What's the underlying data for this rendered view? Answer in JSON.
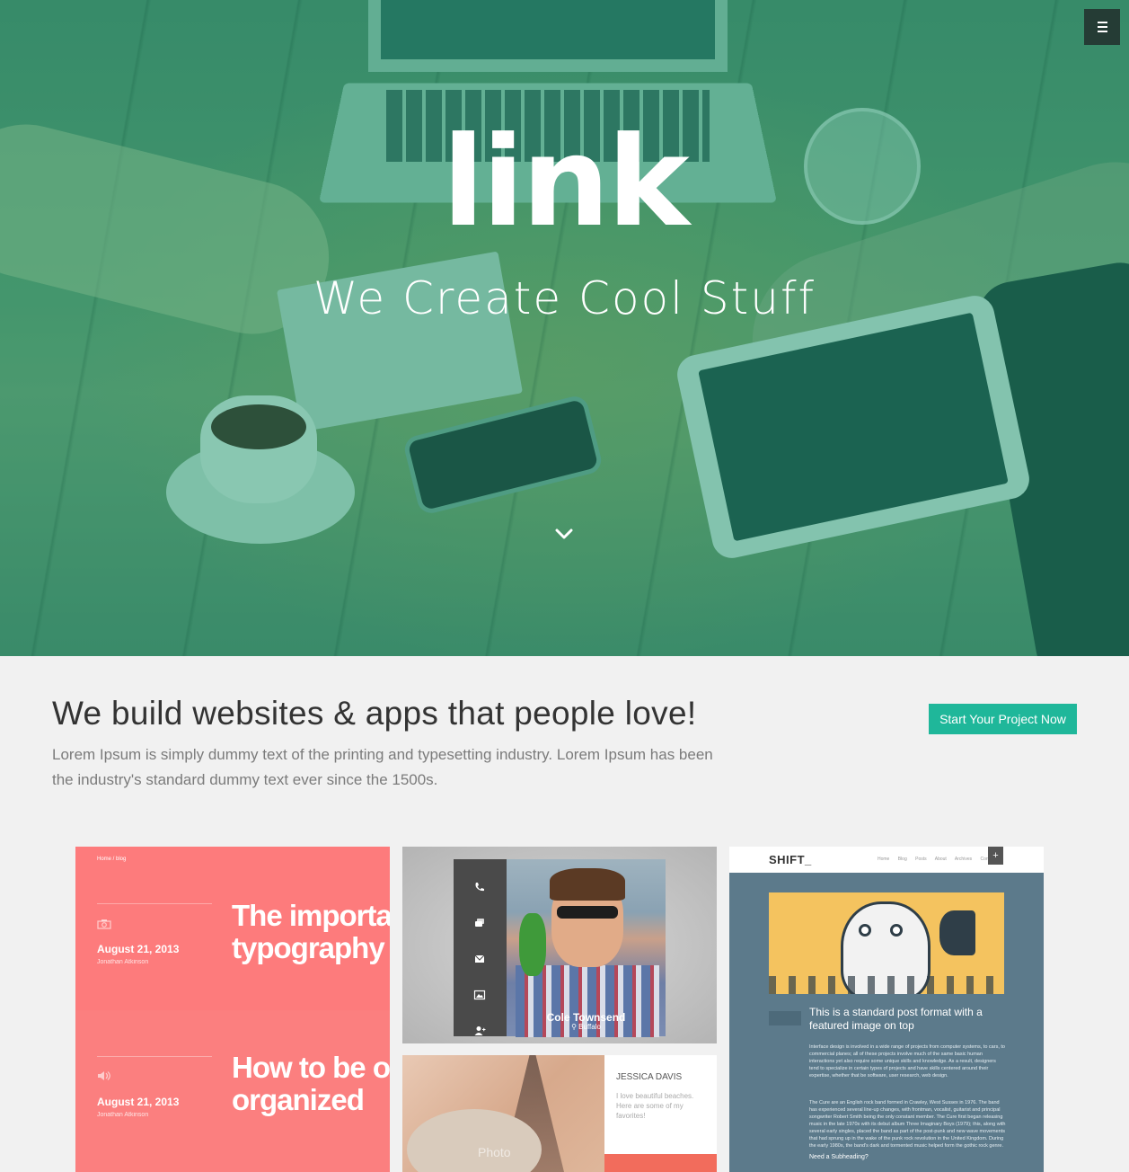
{
  "hero": {
    "brand": "link",
    "tagline": "We Create Cool Stuff"
  },
  "intro": {
    "title": "We build websites & apps that people love!",
    "text": "Lorem Ipsum is simply dummy text of the printing and typesetting industry. Lorem Ipsum has been the industry's standard dummy text ever since the 1500s.",
    "cta_label": "Start Your Project Now"
  },
  "colors": {
    "accent": "#1fb79a",
    "coral": "#fd7b7c",
    "slate": "#5c7a8b",
    "menu_bg": "#253c35"
  },
  "portfolio": {
    "blog_tile": {
      "breadcrumb": "Home  /  blog",
      "posts": [
        {
          "date": "August 21, 2013",
          "author": "Jonathan Atkinson",
          "headline_line1": "The importa",
          "headline_line2": "typography"
        },
        {
          "date": "August 21, 2013",
          "author": "Jonathan Atkinson",
          "headline_line1": "How to be o",
          "headline_line2": "organized"
        }
      ]
    },
    "profile_tile": {
      "name": "Cole Townsend",
      "location": "Buffalo"
    },
    "jessica_tile": {
      "name": "JESSICA DAVIS",
      "text": "I love beautiful beaches. Here are some of my favorites!",
      "watermark": "Photo"
    },
    "shift_tile": {
      "logo": "SHIFT_",
      "nav": "Home Blog Posts About Archives Contact",
      "plus": "+",
      "post_title": "This is a standard post format with a featured image on top",
      "para1": "Interface design is involved in a wide range of projects from computer systems, to cars, to commercial planes; all of these projects involve much of the same basic human interactions yet also require some unique skills and knowledge. As a result, designers tend to specialize in certain types of projects and have skills centered around their expertise, whether that be software, user research, web design.",
      "para2": "The Cure are an English rock band formed in Crawley, West Sussex in 1976. The band has experienced several line-up changes, with frontman, vocalist, guitarist and principal songwriter Robert Smith being the only constant member. The Cure first began releasing music in the late 1970s with its debut album Three Imaginary Boys (1979); this, along with several early singles, placed the band as part of the post-punk and new wave movements that had sprung up in the wake of the punk rock revolution in the United Kingdom. During the early 1980s, the band's dark and tormented music helped form the gothic rock genre.",
      "subheading": "Need a Subheading?"
    }
  }
}
